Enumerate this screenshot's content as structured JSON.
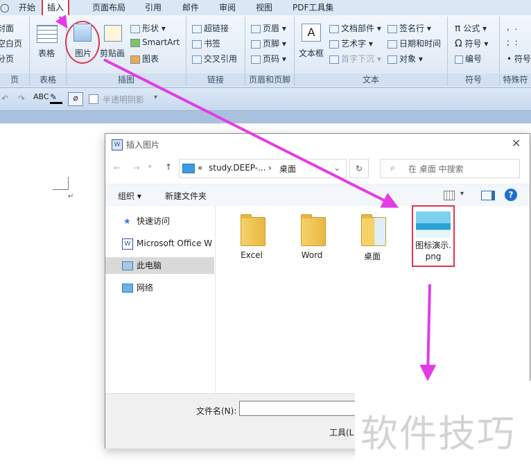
{
  "menu": {
    "tabs": [
      "开始",
      "插入",
      "页面布局",
      "引用",
      "邮件",
      "审阅",
      "视图",
      "PDF工具集"
    ],
    "active_tab": "插入"
  },
  "ribbon": {
    "pages_group": {
      "items": [
        "封面",
        "空白页",
        "分页"
      ],
      "label": "页"
    },
    "table_group": {
      "button": "表格",
      "label": "表格"
    },
    "illustrations_group": {
      "picture": "图片",
      "clipart": "剪贴画",
      "shapes": "形状",
      "smartart": "SmartArt",
      "chart": "图表",
      "label": "插图"
    },
    "links_group": {
      "hyperlink": "超链接",
      "bookmark": "书签",
      "crossref": "交叉引用",
      "label": "链接"
    },
    "header_footer_group": {
      "header": "页眉",
      "footer": "页脚",
      "page_number": "页码",
      "label": "页眉和页脚"
    },
    "text_group": {
      "textbox": "文本框",
      "quickparts": "文档部件",
      "wordart": "艺术字",
      "dropcap": "首字下沉",
      "signature": "签名行",
      "datetime": "日期和时间",
      "object": "对象",
      "label": "文本"
    },
    "symbols_group": {
      "equation": "公式",
      "symbol": "符号",
      "numbering": "编号",
      "label": "符号"
    },
    "special_group": {
      "symbol": "符号",
      "label": "特殊符"
    }
  },
  "toolbar": {
    "shadow_checkbox": "半透明阴影"
  },
  "dialog": {
    "title": "插入图片",
    "breadcrumb": [
      "«",
      "study.DEEP-...",
      "›",
      "桌面"
    ],
    "search_placeholder": "在 桌面 中搜索",
    "organize": "组织 ▾",
    "new_folder": "新建文件夹",
    "help": "?",
    "sidebar": [
      "快速访问",
      "Microsoft Office W",
      "此电脑",
      "网络"
    ],
    "files": [
      {
        "name": "Excel"
      },
      {
        "name": "Word"
      },
      {
        "name": "桌面"
      },
      {
        "name": "图标演示.png"
      }
    ],
    "filename_label": "文件名(N):",
    "filename_value": "",
    "tools_label": "工具(L"
  },
  "watermark": "软件技巧",
  "colors": {
    "highlight": "#e0344c",
    "arrow": "#e23ce6"
  }
}
